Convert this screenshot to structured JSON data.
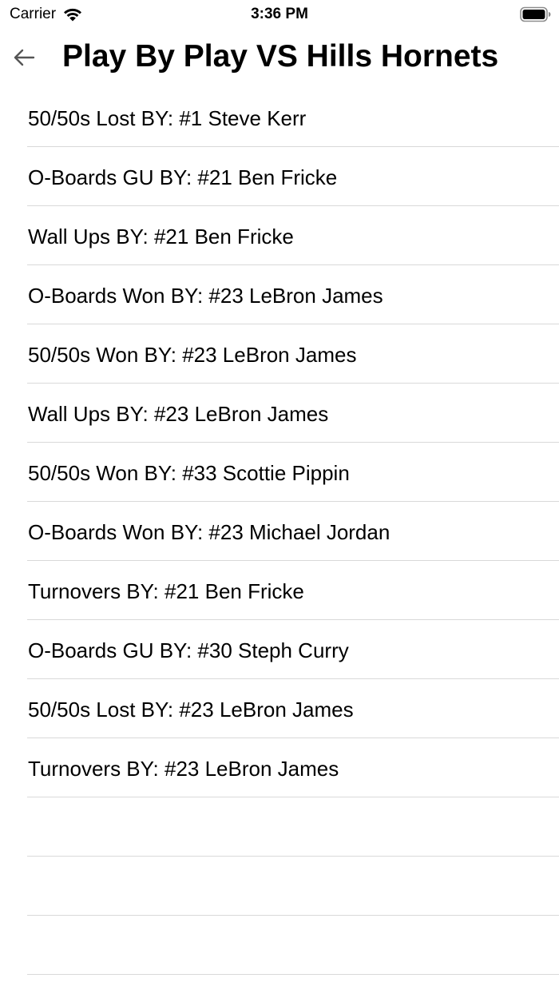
{
  "status_bar": {
    "carrier": "Carrier",
    "time": "3:36 PM",
    "icons": [
      "wifi-icon",
      "battery-icon"
    ]
  },
  "nav": {
    "back_icon": "arrow-left-icon",
    "title": "Play By Play VS Hills Hornets"
  },
  "plays": [
    "50/50s Lost BY: #1 Steve Kerr",
    "O-Boards GU BY: #21 Ben Fricke",
    "Wall Ups BY: #21 Ben Fricke",
    "O-Boards Won BY: #23 LeBron James",
    "50/50s Won BY: #23 LeBron James",
    "Wall Ups BY: #23 LeBron James",
    "50/50s Won BY: #33 Scottie Pippin",
    "O-Boards Won BY: #23 Michael Jordan",
    "Turnovers BY: #21 Ben Fricke",
    "O-Boards GU BY: #30 Steph Curry",
    "50/50s Lost BY: #23 LeBron James",
    "Turnovers BY: #23 LeBron James",
    "",
    "",
    ""
  ],
  "colors": {
    "separator": "#d9d9d9",
    "text": "#000000",
    "back_arrow": "#555555"
  }
}
